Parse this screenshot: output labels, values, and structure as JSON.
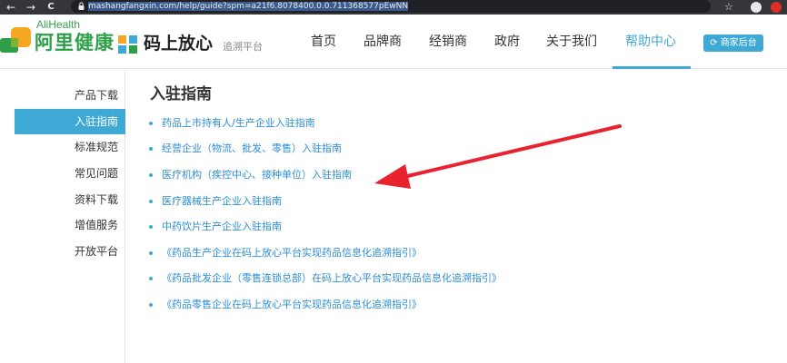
{
  "browser": {
    "back": "←",
    "forward": "→",
    "reload": "C",
    "url": "mashangfangxin.com/help/guide?spm=a21f6.8078400.0.0.711368577pEwNN",
    "star": "☆"
  },
  "header": {
    "brand_en": "AliHealth",
    "brand_cn": "阿里健康",
    "product": "码上放心",
    "product_sub": "追溯平台",
    "nav": [
      "首页",
      "品牌商",
      "经销商",
      "政府",
      "关于我们",
      "帮助中心"
    ],
    "active_nav": "帮助中心",
    "merchant_button": "商家后台"
  },
  "sidebar": {
    "items": [
      "产品下载",
      "入驻指南",
      "标准规范",
      "常见问题",
      "资料下载",
      "增值服务",
      "开放平台"
    ],
    "active": "入驻指南"
  },
  "main": {
    "title": "入驻指南",
    "guides": [
      "药品上市持有人/生产企业入驻指南",
      "经营企业（物流、批发、零售）入驻指南",
      "医疗机构（疾控中心、接种单位）入驻指南",
      "医疗器械生产企业入驻指南",
      "中药饮片生产企业入驻指南",
      "《药品生产企业在码上放心平台实现药品信息化追溯指引》",
      "《药品批发企业（零售连锁总部）在码上放心平台实现药品信息化追溯指引》",
      "《药品零售企业在码上放心平台实现药品信息化追溯指引》"
    ]
  },
  "colors": {
    "accent": "#3fa9d6",
    "link": "#2d8ed6",
    "brand_green": "#2fa04a",
    "annotation_arrow": "#e8222e"
  }
}
